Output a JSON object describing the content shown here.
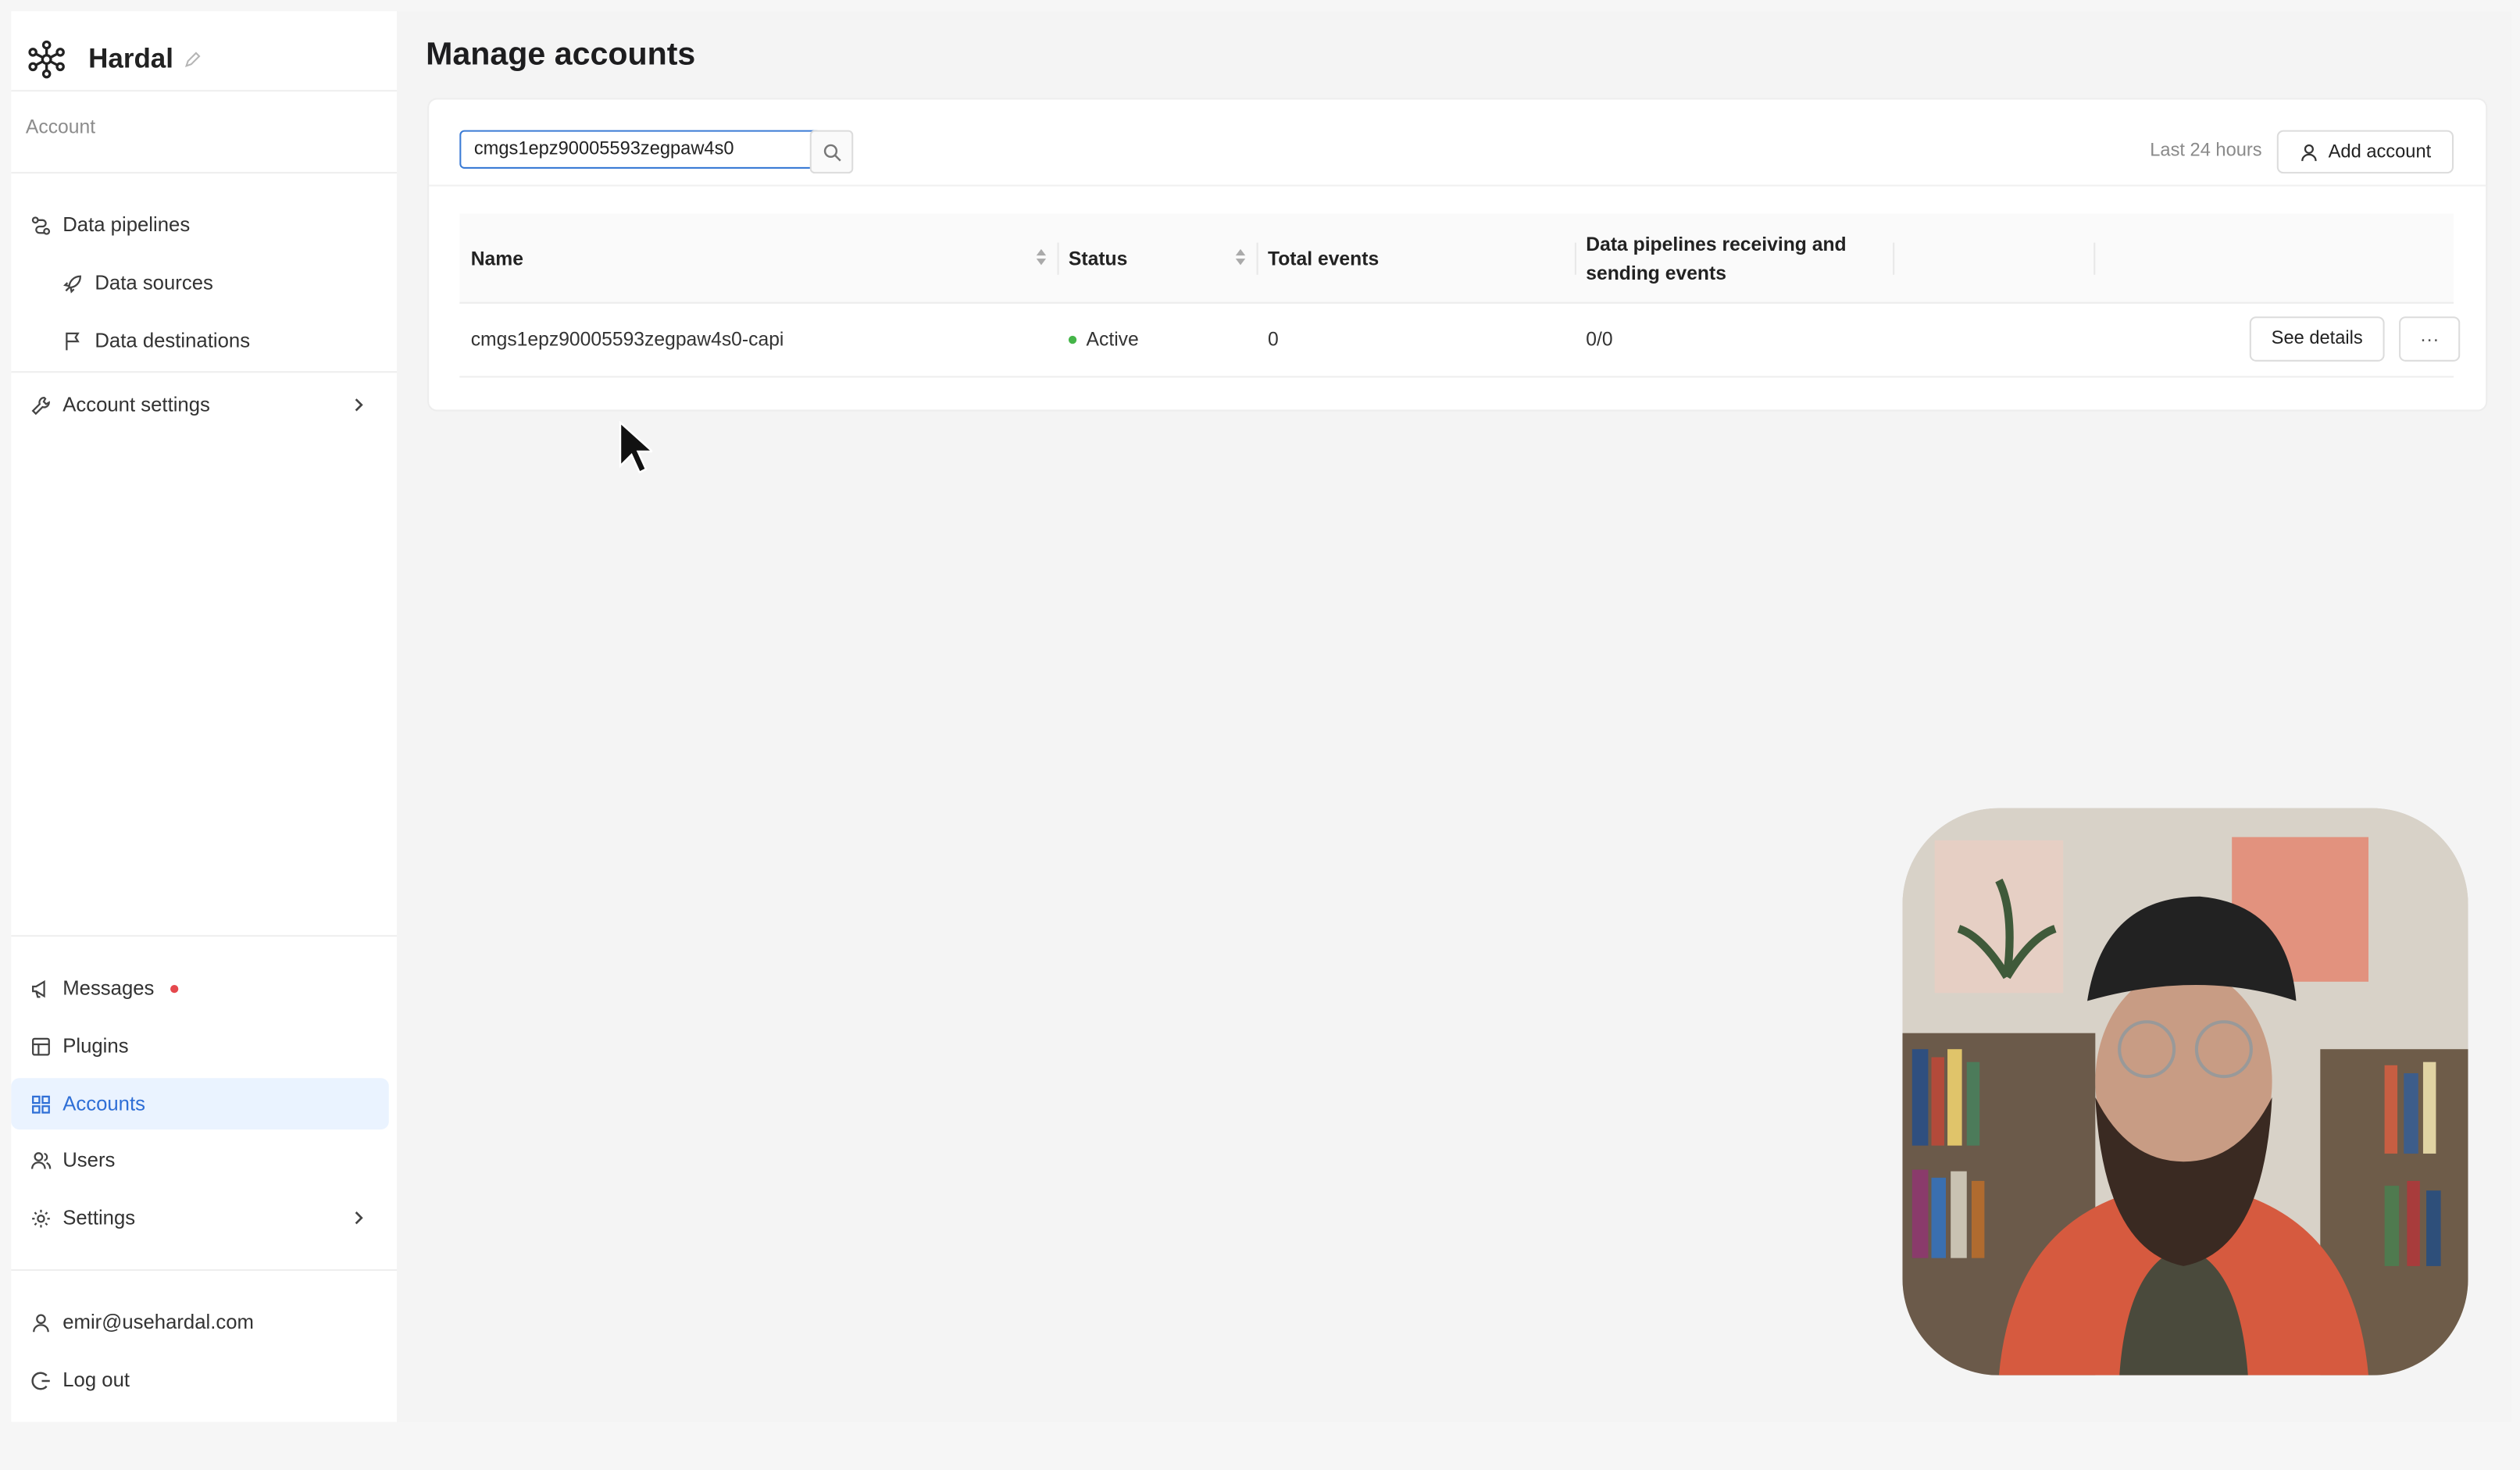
{
  "app": {
    "name": "Hardal"
  },
  "sidebar": {
    "section_label": "Account",
    "pipelines": [
      {
        "label": "Data pipelines",
        "icon": "pipeline-icon"
      },
      {
        "label": "Data sources",
        "icon": "rocket-icon"
      },
      {
        "label": "Data destinations",
        "icon": "flag-icon"
      },
      {
        "label": "Account settings",
        "icon": "wrench-icon"
      }
    ],
    "bottom": [
      {
        "label": "Messages",
        "icon": "megaphone-icon",
        "badge": true
      },
      {
        "label": "Plugins",
        "icon": "plugin-icon"
      },
      {
        "label": "Accounts",
        "icon": "grid-icon",
        "active": true
      },
      {
        "label": "Users",
        "icon": "users-icon"
      },
      {
        "label": "Settings",
        "icon": "gear-icon"
      }
    ],
    "user_email": "emir@usehardal.com",
    "logout_label": "Log out"
  },
  "page": {
    "title": "Manage accounts",
    "search": {
      "value": "cmgs1epz90005593zegpaw4s0"
    },
    "time_range": "Last 24 hours",
    "add_account_label": "Add account",
    "table": {
      "columns": [
        "Name",
        "Status",
        "Total events",
        "Data pipelines receiving and",
        "sending events"
      ],
      "rows": [
        {
          "name": "cmgs1epz90005593zegpaw4s0-capi",
          "status": "Active",
          "total_events": "0",
          "pipelines": "0/0",
          "details_label": "See details",
          "more_label": "···"
        }
      ]
    }
  },
  "colors": {
    "accent": "#2f6fd6",
    "active_bg": "#eaf3ff",
    "status_active": "#45b549",
    "badge": "#e5484d"
  }
}
